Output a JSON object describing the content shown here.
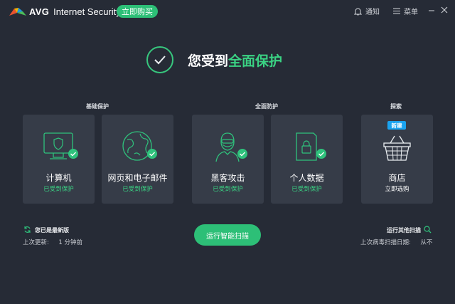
{
  "titlebar": {
    "brand": "AVG",
    "product": "Internet Security",
    "buy_label": "立即购买",
    "notifications_label": "通知",
    "menu_label": "菜单"
  },
  "header": {
    "headline_prefix": "您受到",
    "headline_highlight": "全面保护"
  },
  "sections": {
    "basic": "基础保护",
    "full": "全面防护",
    "explore": "探索"
  },
  "cards": [
    {
      "title": "计算机",
      "status": "已受到保护",
      "icon": "monitor-shield-icon"
    },
    {
      "title": "网页和电子邮件",
      "status": "已受到保护",
      "icon": "globe-icon"
    },
    {
      "title": "黑客攻击",
      "status": "已受到保护",
      "icon": "hacker-icon"
    },
    {
      "title": "个人数据",
      "status": "已受到保护",
      "icon": "lock-document-icon"
    }
  ],
  "store": {
    "badge": "新建",
    "title": "商店",
    "subtitle": "立即选购",
    "icon": "basket-icon"
  },
  "bottom": {
    "update_title": "您已是最新版",
    "update_sub": "上次更新:     1 分钟前",
    "scan_button": "运行智能扫描",
    "other_scan": "运行其他扫描",
    "last_scan": "上次病毒扫描日期:     从不"
  },
  "colors": {
    "background": "#262b36",
    "card": "#363c48",
    "accent": "#2dbf77",
    "badge": "#1aa3f0"
  }
}
